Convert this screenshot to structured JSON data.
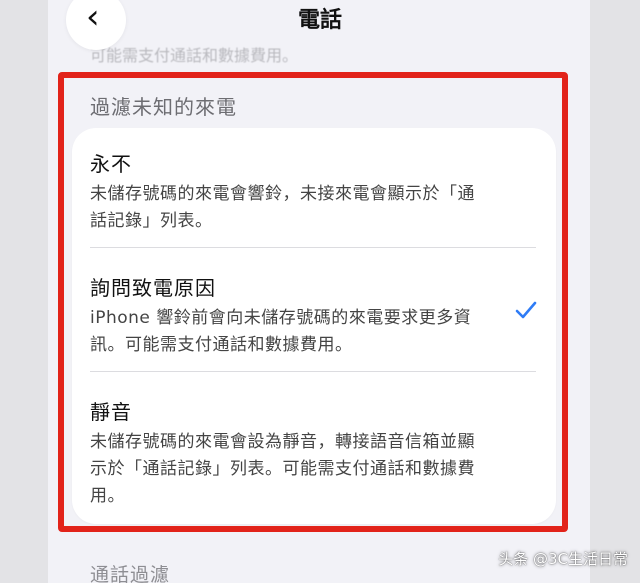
{
  "nav": {
    "title": "電話",
    "back_icon": "chevron-left-icon"
  },
  "previous_section": {
    "faded_text": "可能需支付通話和數據費用。"
  },
  "filter_unknown_callers": {
    "header": "過濾未知的來電",
    "options": [
      {
        "title": "永不",
        "description": "未儲存號碼的來電會響鈴，未接來電會顯示於「通話記錄」列表。",
        "selected": false
      },
      {
        "title": "詢問致電原因",
        "description": "iPhone 響鈴前會向未儲存號碼的來電要求更多資訊。可能需支付通話和數據費用。",
        "selected": true
      },
      {
        "title": "靜音",
        "description": "未儲存號碼的來電會設為靜音，轉接語音信箱並顯示於「通話記錄」列表。可能需支付通話和數據費用。",
        "selected": false
      }
    ]
  },
  "next_section": {
    "header": "通話過濾"
  },
  "watermark": "头条 @3C生活日常",
  "colors": {
    "highlight_border": "#e2231a",
    "checkmark": "#2f7cf6",
    "background": "#f2f2f7"
  }
}
